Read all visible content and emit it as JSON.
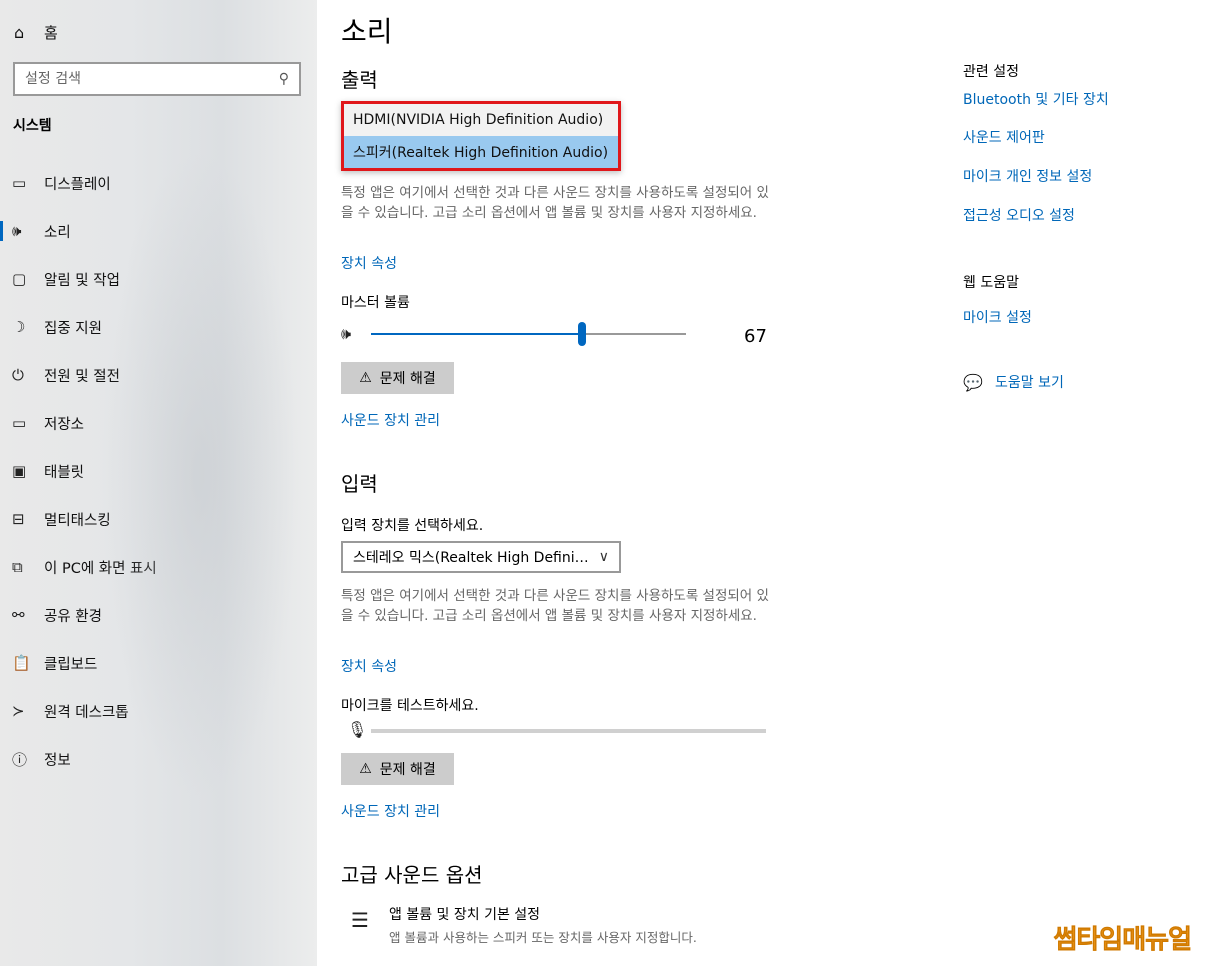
{
  "sidebar": {
    "home_label": "홈",
    "search_placeholder": "설정 검색",
    "section_title": "시스템",
    "items": [
      {
        "label": "디스플레이",
        "icon": "monitor-icon",
        "glyph": "▭"
      },
      {
        "label": "소리",
        "icon": "speaker-icon",
        "glyph": "🕪",
        "active": true
      },
      {
        "label": "알림 및 작업",
        "icon": "notification-icon",
        "glyph": "▢"
      },
      {
        "label": "집중 지원",
        "icon": "moon-icon",
        "glyph": "☽"
      },
      {
        "label": "전원 및 절전",
        "icon": "power-icon",
        "glyph": "⏻"
      },
      {
        "label": "저장소",
        "icon": "storage-icon",
        "glyph": "▭"
      },
      {
        "label": "태블릿",
        "icon": "tablet-icon",
        "glyph": "▣"
      },
      {
        "label": "멀티태스킹",
        "icon": "multitasking-icon",
        "glyph": "⊟"
      },
      {
        "label": "이 PC에 화면 표시",
        "icon": "project-icon",
        "glyph": "⧉"
      },
      {
        "label": "공유 환경",
        "icon": "share-icon",
        "glyph": "⚯"
      },
      {
        "label": "클립보드",
        "icon": "clipboard-icon",
        "glyph": "📋"
      },
      {
        "label": "원격 데스크톱",
        "icon": "remote-desktop-icon",
        "glyph": "≻"
      },
      {
        "label": "정보",
        "icon": "info-icon",
        "glyph": "ⓘ"
      }
    ]
  },
  "main": {
    "title": "소리",
    "output": {
      "heading": "출력",
      "dropdown_options": [
        "HDMI(NVIDIA High Definition Audio)",
        "스피커(Realtek High Definition Audio)"
      ],
      "selected_option_index": 1,
      "description": "특정 앱은 여기에서 선택한 것과 다른 사운드 장치를 사용하도록 설정되어 있을 수 있습니다. 고급 소리 옵션에서 앱 볼륨 및 장치를 사용자 지정하세요.",
      "device_properties_link": "장치 속성",
      "master_volume_label": "마스터 볼륨",
      "volume_value": "67",
      "volume_level": 67,
      "troubleshoot_label": "문제 해결",
      "manage_devices_link": "사운드 장치 관리"
    },
    "input": {
      "heading": "입력",
      "select_label": "입력 장치를 선택하세요.",
      "selected_device": "스테레오 믹스(Realtek High Definiti...",
      "description": "특정 앱은 여기에서 선택한 것과 다른 사운드 장치를 사용하도록 설정되어 있을 수 있습니다. 고급 소리 옵션에서 앱 볼륨 및 장치를 사용자 지정하세요.",
      "device_properties_link": "장치 속성",
      "mic_test_label": "마이크를 테스트하세요.",
      "mic_level": 0,
      "troubleshoot_label": "문제 해결",
      "manage_devices_link": "사운드 장치 관리"
    },
    "advanced": {
      "heading": "고급 사운드 옵션",
      "item_title": "앱 볼륨 및 장치 기본 설정",
      "item_desc": "앱 볼륨과 사용하는 스피커 또는 장치를 사용자 지정합니다."
    }
  },
  "right": {
    "related_heading": "관련 설정",
    "related_links": [
      "Bluetooth 및 기타 장치",
      "사운드 제어판",
      "마이크 개인 정보 설정",
      "접근성 오디오 설정"
    ],
    "web_help_heading": "웹 도움말",
    "web_help_links": [
      "마이크 설정"
    ],
    "get_help_label": "도움말 보기"
  },
  "watermark": "썸타임매뉴얼",
  "colors": {
    "accent": "#0067c0",
    "link": "#0067b8",
    "dropdown_highlight": "#e0171b",
    "watermark": "#f39a1e"
  }
}
